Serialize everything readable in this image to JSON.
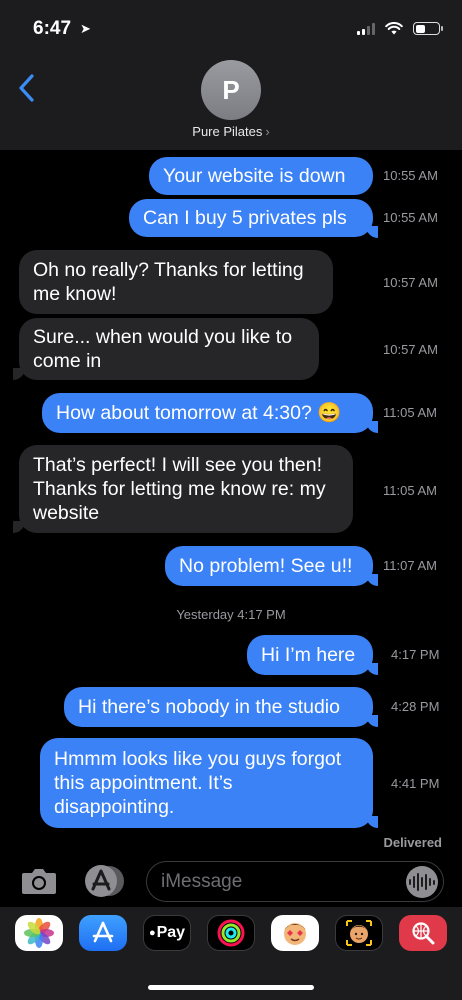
{
  "status": {
    "time": "6:47"
  },
  "contact": {
    "initial": "P",
    "name": "Pure Pilates"
  },
  "messages": [
    {
      "text": "Your website is down",
      "time": "10:55 AM"
    },
    {
      "text": "Can I buy 5 privates pls",
      "time": "10:55 AM"
    },
    {
      "line1": "Oh no really? Thanks for letting",
      "line2": "me know!",
      "time": "10:57 AM"
    },
    {
      "line1": "Sure... when would you like to",
      "line2": "come in",
      "time": "10:57 AM"
    },
    {
      "text": "How about tomorrow at 4:30? 😄",
      "time": "11:05 AM"
    },
    {
      "line1": "That’s perfect! I will see you then!",
      "line2": "Thanks for letting me know re: my",
      "line3": "website",
      "time": "11:05 AM"
    },
    {
      "text": "No problem! See u!!",
      "time": "11:07 AM"
    },
    {
      "text": "Hi I’m here",
      "time": "4:17 PM"
    },
    {
      "text": "Hi there’s nobody in the studio",
      "time": "4:28 PM"
    },
    {
      "line1": "Hmmm looks like you guys forgot",
      "line2": "this appointment. It’s",
      "line3": "disappointing.",
      "time": "4:41 PM"
    }
  ],
  "divider": "Yesterday 4:17 PM",
  "delivered": "Delivered",
  "input": {
    "placeholder": "iMessage"
  },
  "apps": {
    "apple_pay_label": "Pay",
    "icons": [
      "photos-icon",
      "app-store-icon",
      "apple-pay-icon",
      "activity-icon",
      "memoji-stickers-icon",
      "memoji-icon",
      "web-search-icon"
    ]
  },
  "colors": {
    "sent": "#3b82f6",
    "received": "#262628",
    "accent": "#3b8df6"
  }
}
